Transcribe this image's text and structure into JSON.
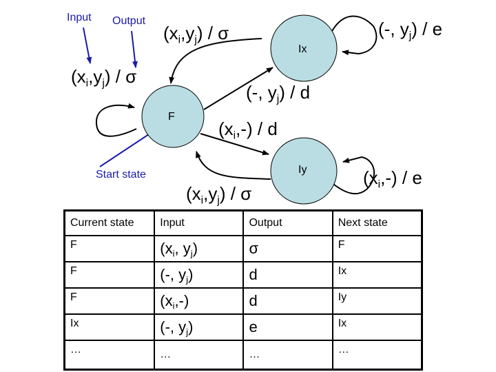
{
  "annotations": {
    "input": "Input",
    "output": "Output",
    "start_state": "Start state"
  },
  "states": {
    "F": "F",
    "Ix": "Ix",
    "Iy": "Iy"
  },
  "colors": {
    "state_fill": "#b9dde2",
    "annotation_blue": "#1a1aa6"
  },
  "transitions": [
    {
      "from": "F",
      "to": "F",
      "input_main": "(x",
      "input_sub1": "i",
      "input_mid": ",y",
      "input_sub2": "j",
      "input_end": ")",
      "output": " / σ"
    },
    {
      "from": "Ix",
      "to": "F",
      "input_main": "(x",
      "input_sub1": "i",
      "input_mid": ",y",
      "input_sub2": "j",
      "input_end": ")",
      "output": " / σ"
    },
    {
      "from": "Ix",
      "to": "Ix",
      "input_main": "(-, y",
      "input_sub1": "j",
      "input_end": ")",
      "output": " / e"
    },
    {
      "from": "F",
      "to": "Ix",
      "input_main": "(-, y",
      "input_sub1": "j",
      "input_end": ")",
      "output": " / d"
    },
    {
      "from": "F",
      "to": "Iy",
      "input_main": "(x",
      "input_sub1": "i",
      "input_end": ",-)",
      "output": " / d"
    },
    {
      "from": "Iy",
      "to": "F",
      "input_main": "(x",
      "input_sub1": "i",
      "input_mid": ",y",
      "input_sub2": "j",
      "input_end": ")",
      "output": " / σ"
    },
    {
      "from": "Iy",
      "to": "Iy",
      "input_main": "(x",
      "input_sub1": "i",
      "input_end": ",-)",
      "output": " / e"
    }
  ],
  "table": {
    "headers": [
      "Current state",
      "Input",
      "Output",
      "Next state"
    ],
    "rows": [
      {
        "current": "F",
        "input_a": "(x",
        "input_s1": "i",
        "input_b": ", y",
        "input_s2": "j",
        "input_c": ")",
        "output": "σ",
        "next": "F"
      },
      {
        "current": "F",
        "input_a": "(-, y",
        "input_s1": "j",
        "input_b": "",
        "input_s2": "",
        "input_c": ")",
        "output": "d",
        "next": "Ix"
      },
      {
        "current": "F",
        "input_a": "(x",
        "input_s1": "i",
        "input_b": ",-)",
        "input_s2": "",
        "input_c": "",
        "output": "d",
        "next": "Iy"
      },
      {
        "current": "Ix",
        "input_a": "(-, y",
        "input_s1": "j",
        "input_b": "",
        "input_s2": "",
        "input_c": ")",
        "output": "e",
        "next": "Ix"
      },
      {
        "current": "…",
        "input_a": "…",
        "input_s1": "",
        "input_b": "",
        "input_s2": "",
        "input_c": "",
        "output": "…",
        "next": "…"
      }
    ]
  }
}
